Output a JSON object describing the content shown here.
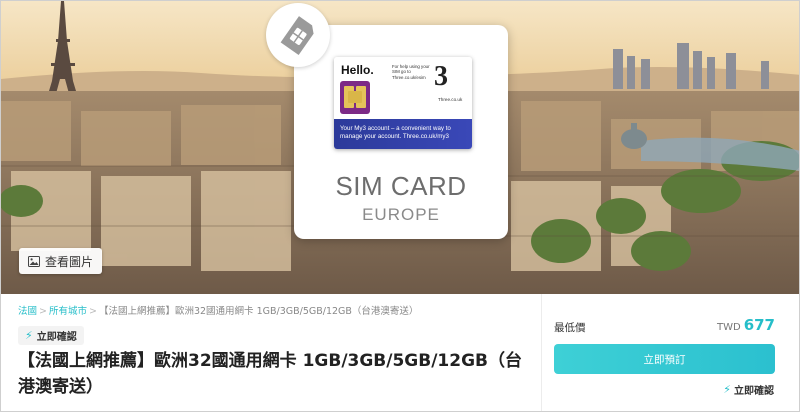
{
  "hero": {
    "view_photos_label": "查看圖片",
    "product_card": {
      "sim_hello": "Hello.",
      "sim_note": "For help using your SIM go to Three.co.uk/esim",
      "sim_brand": "3",
      "sim_brand_url": "Three.co.uk",
      "sim_footer": "Your My3 account – a convenient way to manage your account. Three.co.uk/my3",
      "title": "SIM CARD",
      "subtitle": "EUROPE"
    }
  },
  "breadcrumb": {
    "items": [
      {
        "label": "法國"
      },
      {
        "label": "所有城市"
      }
    ],
    "current": "【法國上網推薦】歐洲32國通用網卡 1GB/3GB/5GB/12GB（台港澳寄送）",
    "separator": ">"
  },
  "instant_badge": {
    "label": "立即確認",
    "icon": "lightning-bolt-icon"
  },
  "product": {
    "title": "【法國上網推薦】歐洲32國通用網卡 1GB/3GB/5GB/12GB（台港澳寄送）"
  },
  "booking": {
    "price_label": "最低價",
    "currency": "TWD",
    "price": "677",
    "book_button_label": "立即預訂",
    "instant_label": "立即確認"
  },
  "colors": {
    "accent": "#26bec9",
    "button": "#3ed0d6",
    "sim_footer": "#2c3a9a"
  }
}
